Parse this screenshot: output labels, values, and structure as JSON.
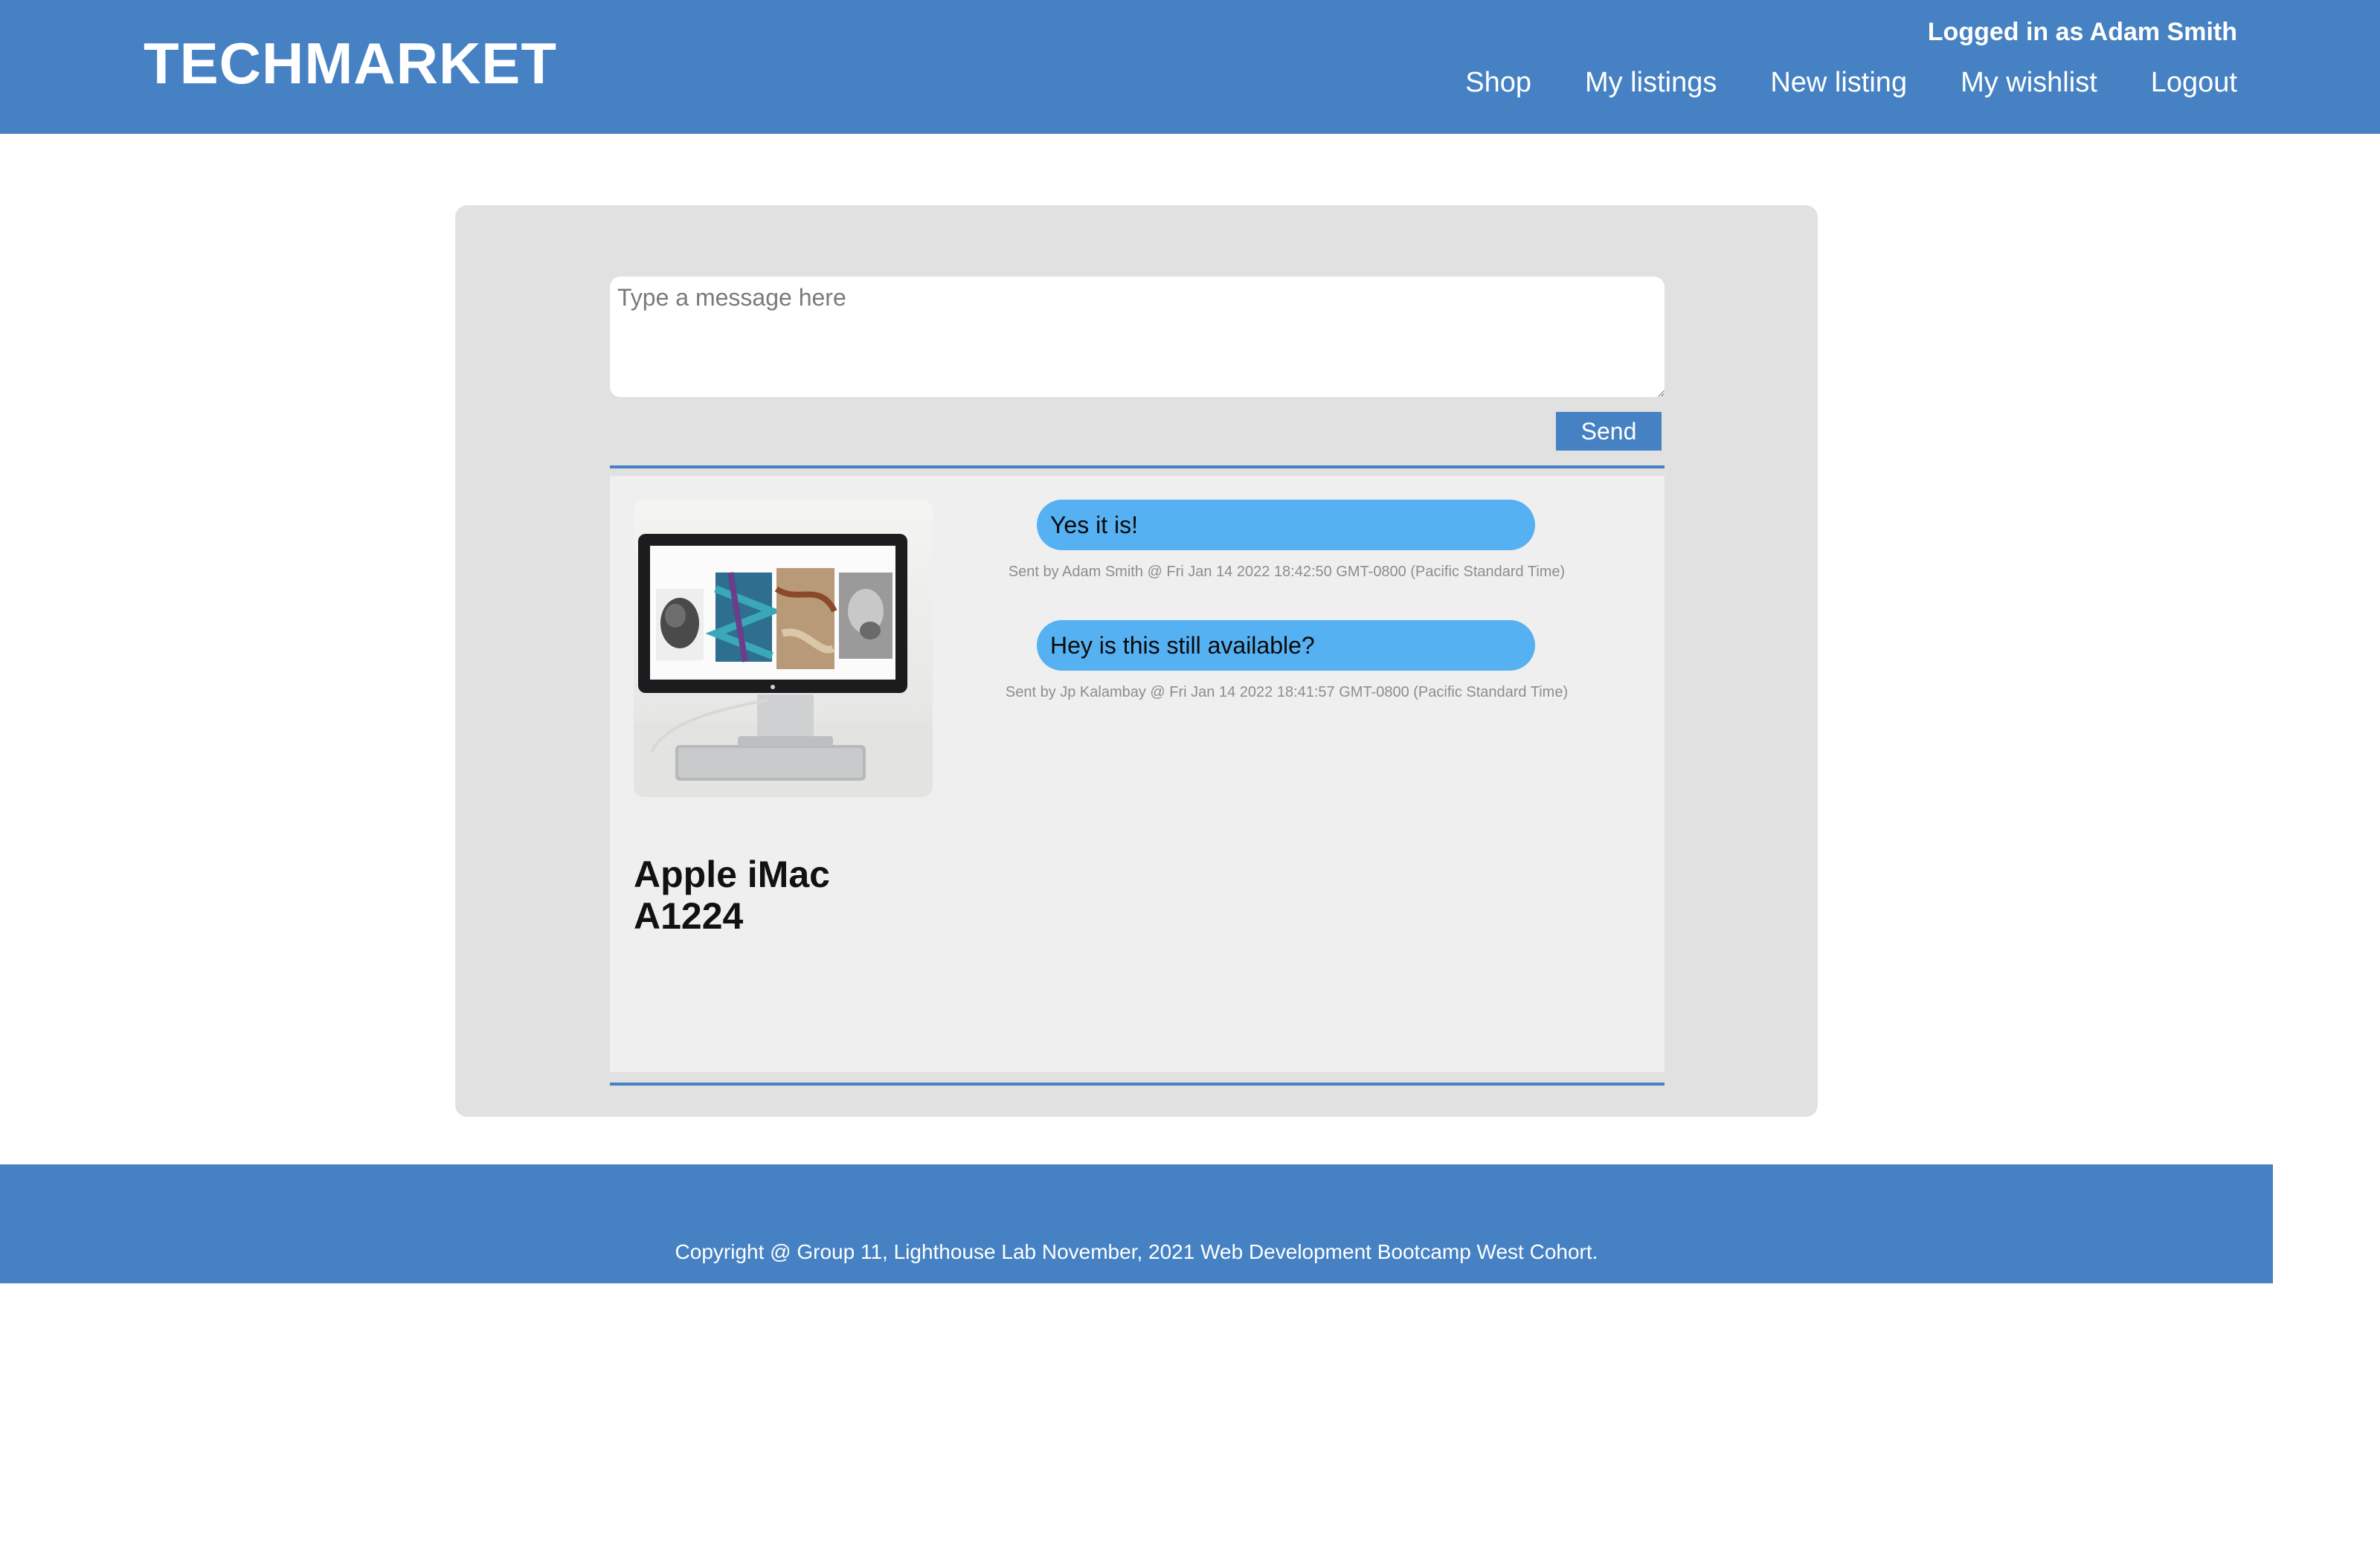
{
  "header": {
    "brand": "TECHMARKET",
    "login_status": "Logged in as Adam Smith",
    "nav": [
      "Shop",
      "My listings",
      "New listing",
      "My wishlist",
      "Logout"
    ]
  },
  "compose": {
    "placeholder": "Type a message here",
    "value": "",
    "send_label": "Send"
  },
  "product": {
    "title_line1": "Apple iMac",
    "title_line2": "A1224",
    "image_icon": "imac-photo"
  },
  "messages": [
    {
      "text": "Yes it is!",
      "meta": "Sent by Adam Smith @ Fri Jan 14 2022 18:42:50 GMT-0800 (Pacific Standard Time)"
    },
    {
      "text": "Hey is this still available?",
      "meta": "Sent by Jp Kalambay @ Fri Jan 14 2022 18:41:57 GMT-0800 (Pacific Standard Time)"
    }
  ],
  "footer": {
    "copyright": "Copyright @ Group 11, Lighthouse Lab November, 2021 Web Development Bootcamp West Cohort."
  },
  "colors": {
    "brand_blue": "#4682c3",
    "bubble_blue": "#55b1f2",
    "card_gray": "#e1e1e1",
    "chat_gray": "#efefef"
  }
}
